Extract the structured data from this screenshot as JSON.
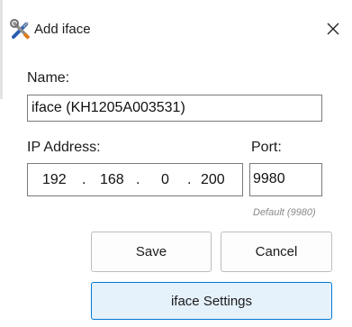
{
  "window": {
    "title": "Add iface",
    "icon": "tools-icon",
    "close_icon": "close-icon"
  },
  "form": {
    "name_label": "Name:",
    "name_value": "iface (KH1205A003531)",
    "ip_label": "IP Address:",
    "ip_octets": [
      "192",
      "168",
      "0",
      "200"
    ],
    "ip_separator": ".",
    "port_label": "Port:",
    "port_value": "9980",
    "port_hint": "Default (9980)"
  },
  "buttons": {
    "save": "Save",
    "cancel": "Cancel",
    "settings": "iface Settings"
  },
  "colors": {
    "accent_border": "#0078d4",
    "accent_bg": "#e5f1fb"
  }
}
